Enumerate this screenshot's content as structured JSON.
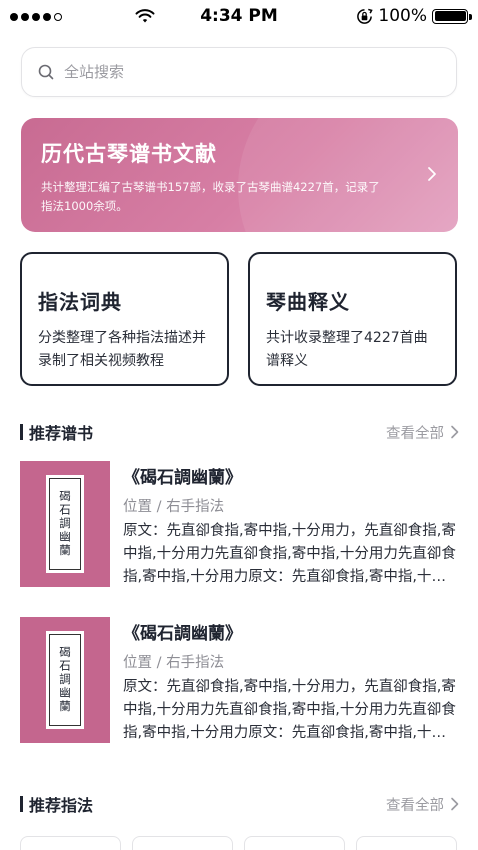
{
  "status_bar": {
    "time": "4:34 PM",
    "battery": "100%"
  },
  "search": {
    "placeholder": "全站搜索"
  },
  "banner": {
    "title": "历代古琴谱书文献",
    "description": "共计整理汇编了古琴谱书157部，收录了古琴曲谱4227首，记录了指法1000余项。"
  },
  "cards": [
    {
      "title": "指法词典",
      "description": "分类整理了各种指法描述并录制了相关视频教程"
    },
    {
      "title": "琴曲释义",
      "description": "共计收录整理了4227首曲谱释义"
    }
  ],
  "recommended_books": {
    "title": "推荐谱书",
    "see_all": "查看全部",
    "items": [
      {
        "cover_text": "碣石調幽蘭",
        "title": "《碣石調幽蘭》",
        "position": "位置 / 右手指法",
        "text": "原文：先直卻食指,寄中指,十分用力，先直卻食指,寄中指,十分用力先直卻食指,寄中指,十分用力先直卻食指,寄中指,十分用力原文：先直卻食指,寄中指,十分用力"
      },
      {
        "cover_text": "碣石調幽蘭",
        "title": "《碣石調幽蘭》",
        "position": "位置 / 右手指法",
        "text": "原文：先直卻食指,寄中指,十分用力，先直卻食指,寄中指,十分用力先直卻食指,寄中指,十分用力先直卻食指,寄中指,十分用力原文：先直卻食指,寄中指,十分用力"
      }
    ]
  },
  "recommended_techniques": {
    "title": "推荐指法",
    "see_all": "查看全部"
  },
  "icons": {
    "search": "search-icon",
    "chevron": "chevron-right-icon"
  },
  "colors": {
    "accent": "#c86b92",
    "text": "#1f2430",
    "muted": "#9b9ba1"
  }
}
